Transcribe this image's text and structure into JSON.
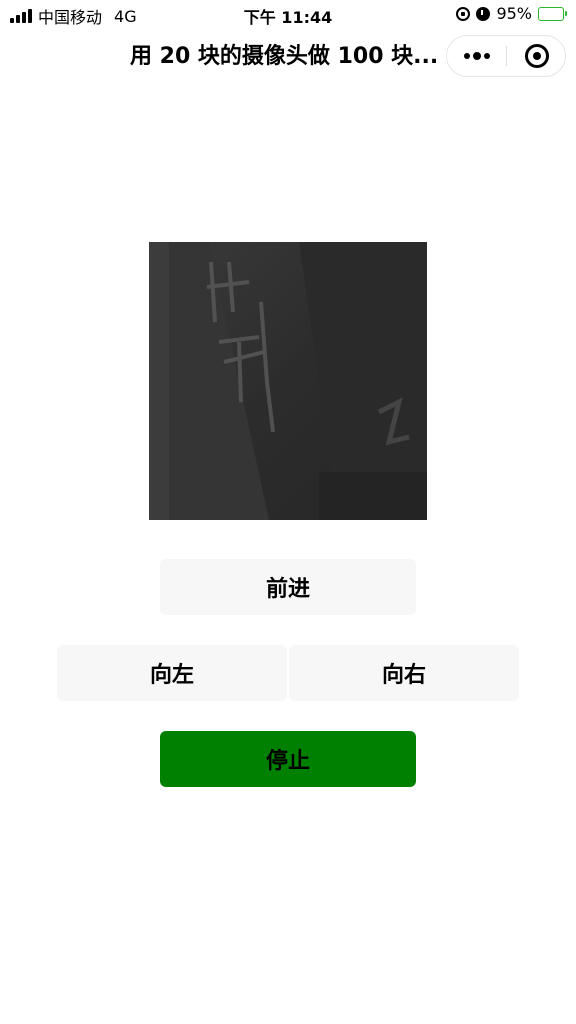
{
  "status_bar": {
    "carrier": "中国移动",
    "network": "4G",
    "time": "下午 11:44",
    "battery_percent": "95%"
  },
  "nav": {
    "title": "用 20 块的摄像头做 100 块..."
  },
  "controls": {
    "forward_label": "前进",
    "left_label": "向左",
    "right_label": "向右",
    "stop_label": "停止"
  },
  "colors": {
    "stop_button": "#008000",
    "button_bg": "#f7f7f7",
    "battery": "#4cd964"
  },
  "icons": {
    "signal": "signal-bars-icon",
    "rotation_lock": "rotation-lock-icon",
    "alarm": "alarm-icon",
    "battery": "battery-charging-icon",
    "more": "more-dots-icon",
    "close": "target-close-icon"
  }
}
